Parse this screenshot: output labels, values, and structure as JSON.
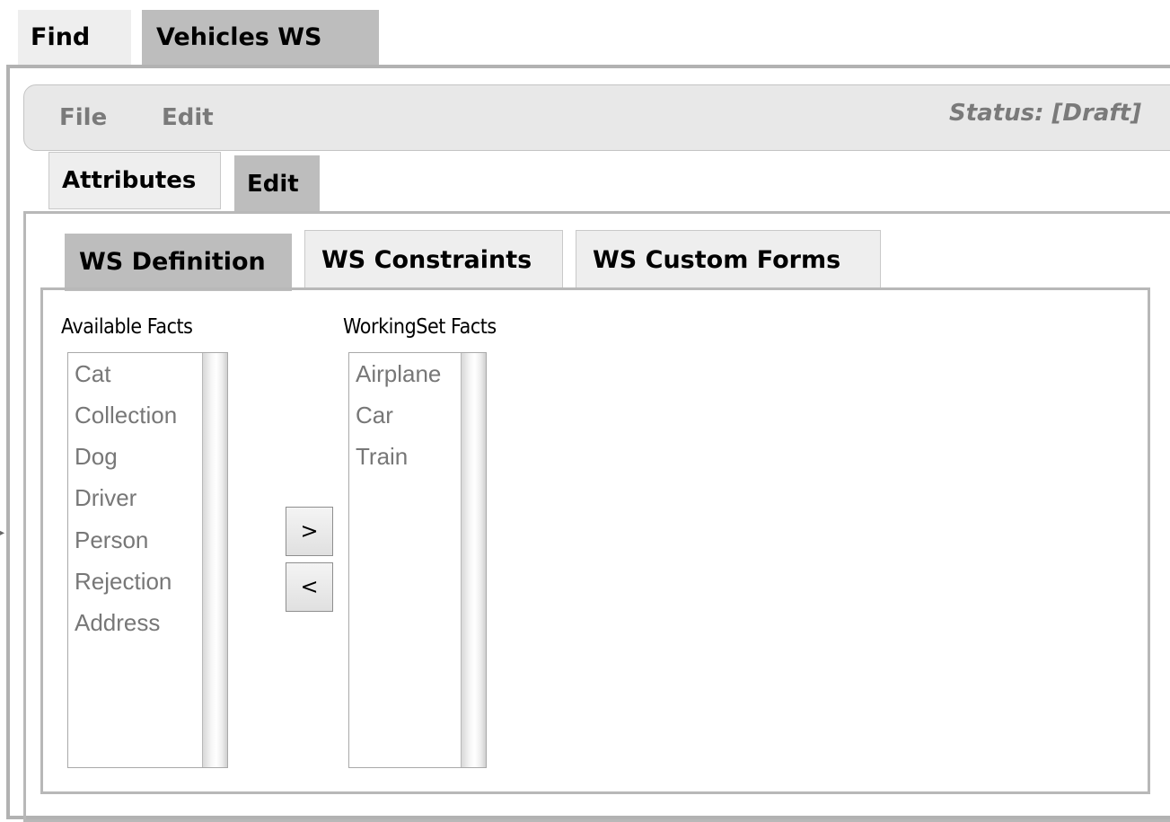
{
  "top_tabs": {
    "find": "Find",
    "vehicles_ws": "Vehicles WS"
  },
  "menubar": {
    "file": "File",
    "edit": "Edit",
    "status": "Status: [Draft]"
  },
  "sub_tabs": {
    "attributes": "Attributes",
    "edit": "Edit"
  },
  "ws_tabs": {
    "definition": "WS Definition",
    "constraints": "WS Constraints",
    "custom_forms": "WS Custom Forms"
  },
  "available_facts": {
    "caption": "Available Facts",
    "items": [
      "Cat",
      "Collection",
      "Dog",
      "Driver",
      "Person",
      "Rejection",
      "Address"
    ]
  },
  "workingset_facts": {
    "caption": "WorkingSet Facts",
    "items": [
      "Airplane",
      "Car",
      "Train"
    ]
  },
  "buttons": {
    "move_right": ">",
    "move_left": "<"
  }
}
